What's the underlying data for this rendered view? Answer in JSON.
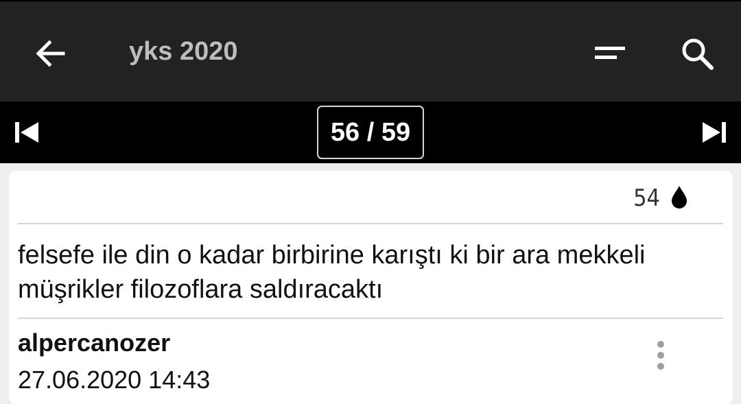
{
  "appbar": {
    "title": "yks 2020",
    "icons": {
      "back": "arrow-left-icon",
      "sort": "sort-icon",
      "search": "search-icon"
    }
  },
  "pager": {
    "label": "56 / 59",
    "current_page": 56,
    "total_pages": 59,
    "icons": {
      "first": "skip-first-icon",
      "last": "skip-last-icon"
    }
  },
  "entry": {
    "favorite_count": "54",
    "favorite_icon": "drop-icon",
    "text": "felsefe ile din o kadar birbirine karıştı ki bir ara mekkeli müşrikler filozoflara saldıracaktı",
    "author": "alpercanozer",
    "date": "27.06.2020 14:43",
    "menu_icon": "more-vertical-icon"
  },
  "colors": {
    "appbar_bg": "#222222",
    "title": "#bdbdbd",
    "pager_bg": "#000000",
    "page_bg": "#efefef",
    "card_bg": "#ffffff"
  }
}
